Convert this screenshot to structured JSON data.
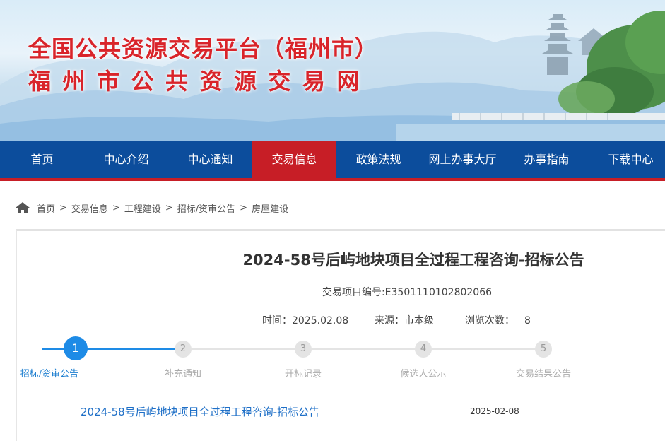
{
  "banner": {
    "title": "全国公共资源交易平台（福州市）",
    "subtitle": "福州市公共资源交易网",
    "title_color": "#d9242a"
  },
  "nav": {
    "items": [
      {
        "label": "首页"
      },
      {
        "label": "中心介绍"
      },
      {
        "label": "中心通知"
      },
      {
        "label": "交易信息",
        "active": true
      },
      {
        "label": "政策法规"
      },
      {
        "label": "网上办事大厅"
      },
      {
        "label": "办事指南"
      },
      {
        "label": "下载中心"
      }
    ],
    "bg_color": "#0c4d9c",
    "active_color": "#c71e26"
  },
  "breadcrumb": {
    "icon": "home-icon",
    "items": [
      "首页",
      "交易信息",
      "工程建设",
      "招标/资审公告",
      "房屋建设"
    ],
    "separator": ">"
  },
  "document": {
    "title": "2024-58号后屿地块项目全过程工程咨询-招标公告",
    "project_code": "交易项目编号:E3501110102802066",
    "time_label": "时间：",
    "time_value": "2025.02.08",
    "source_label": "来源：",
    "source_value": "市本级",
    "views_label": "浏览次数：",
    "views_value": "8"
  },
  "steps": [
    {
      "number": "1",
      "label": "招标/资审公告",
      "active": true
    },
    {
      "number": "2",
      "label": "补充通知",
      "active": false
    },
    {
      "number": "3",
      "label": "开标记录",
      "active": false
    },
    {
      "number": "4",
      "label": "候选人公示",
      "active": false
    },
    {
      "number": "5",
      "label": "交易结果公告",
      "active": false
    }
  ],
  "notices": [
    {
      "title": "2024-58号后屿地块项目全过程工程咨询-招标公告",
      "date": "2025-02-08"
    }
  ],
  "colors": {
    "step_active": "#1e8be6",
    "link": "#1e6fc7"
  }
}
